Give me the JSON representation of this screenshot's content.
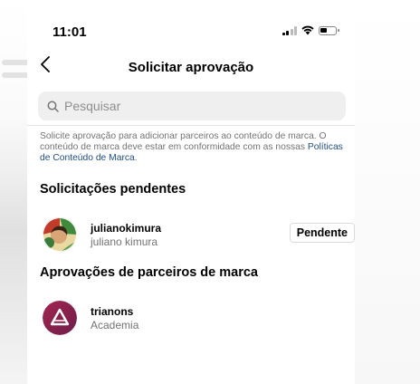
{
  "status_bar": {
    "time": "11:01",
    "battery_level": 0.45
  },
  "header": {
    "title": "Solicitar aprovação"
  },
  "search": {
    "placeholder": "Pesquisar",
    "value": ""
  },
  "description": {
    "text": "Solicite aprovação para adicionar parceiros ao conteúdo de marca. O conteúdo de marca deve estar em conformidade com as nossas ",
    "link": "Políticas de Conteúdo de Marca",
    "end": "."
  },
  "pending": {
    "title": "Solicitações pendentes",
    "items": [
      {
        "username": "julianokimura",
        "fullname": "juliano kimura",
        "action_label": "Pendente"
      }
    ]
  },
  "partners": {
    "title": "Aprovações de parceiros de marca",
    "items": [
      {
        "username": "trianons",
        "category": "Academia"
      }
    ]
  },
  "colors": {
    "link": "#1f4d85",
    "secondary_text": "#737373",
    "search_bg": "#efefef",
    "trianons_avatar": "#8b1f4c"
  },
  "icons": [
    "back-chevron-icon",
    "search-icon",
    "signal-icon",
    "wifi-icon",
    "battery-icon"
  ]
}
